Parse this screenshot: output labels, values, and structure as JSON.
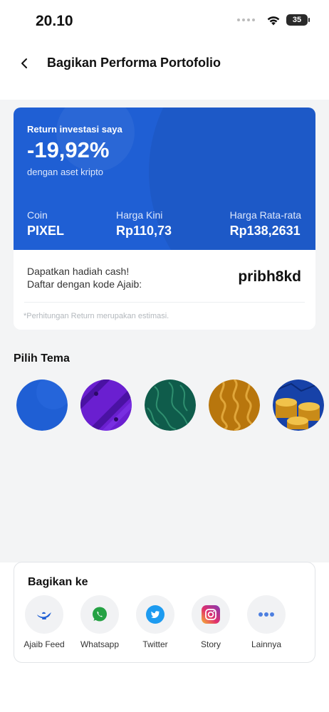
{
  "status": {
    "time": "20.10",
    "battery": "35"
  },
  "header": {
    "title": "Bagikan Performa Portofolio"
  },
  "card": {
    "return_label": "Return investasi saya",
    "return_value": "-19,92%",
    "return_sub": "dengan aset kripto",
    "coin_label": "Coin",
    "coin_value": "PIXEL",
    "harga_kini_label": "Harga Kini",
    "harga_kini_value": "Rp110,73",
    "harga_rata_label": "Harga Rata-rata",
    "harga_rata_value": "Rp138,2631",
    "referral_line1": "Dapatkan hadiah cash!",
    "referral_line2": "Daftar dengan kode Ajaib:",
    "referral_code": "pribh8kd",
    "disclaimer": "*Perhitungan Return merupakan estimasi.",
    "accent": "#1f5fd4"
  },
  "themes": {
    "title": "Pilih Tema",
    "items": [
      {
        "icon": "blue-theme-swatch",
        "color": "#1f5fd4"
      },
      {
        "icon": "purple-theme-swatch",
        "color": "#6a1fd0"
      },
      {
        "icon": "green-theme-swatch",
        "color": "#0f5c4b"
      },
      {
        "icon": "gold-theme-swatch",
        "color": "#b8760d"
      },
      {
        "icon": "coins-theme-swatch",
        "color": "#1742a8"
      }
    ]
  },
  "share": {
    "title": "Bagikan ke",
    "items": [
      {
        "label": "Ajaib Feed",
        "icon": "ajaib-lamp-icon"
      },
      {
        "label": "Whatsapp",
        "icon": "whatsapp-icon"
      },
      {
        "label": "Twitter",
        "icon": "twitter-icon"
      },
      {
        "label": "Story",
        "icon": "instagram-icon"
      },
      {
        "label": "Lainnya",
        "icon": "more-icon"
      }
    ]
  }
}
